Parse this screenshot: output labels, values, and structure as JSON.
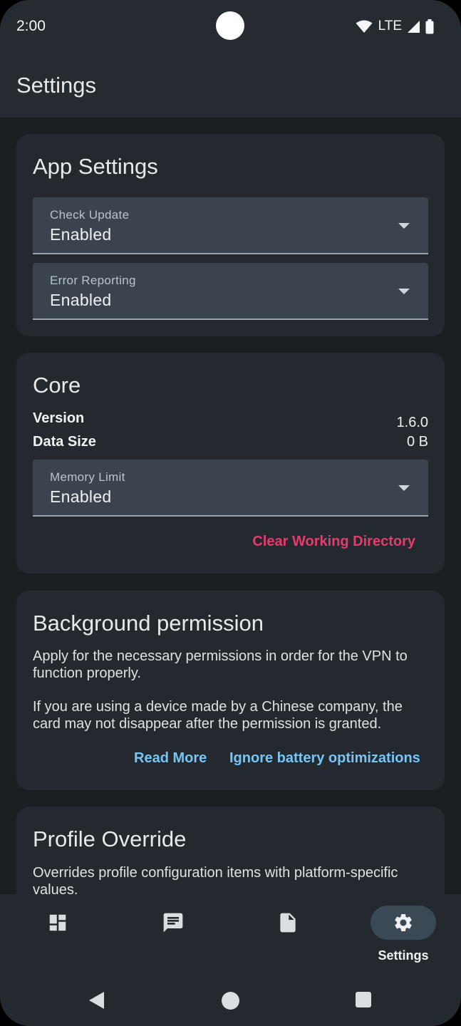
{
  "status_bar": {
    "time": "2:00",
    "network": "LTE",
    "icons": [
      "wifi-icon",
      "signal-icon",
      "battery-icon"
    ]
  },
  "app_bar": {
    "title": "Settings"
  },
  "app_settings": {
    "title": "App Settings",
    "check_update": {
      "label": "Check Update",
      "value": "Enabled"
    },
    "error_reporting": {
      "label": "Error Reporting",
      "value": "Enabled"
    }
  },
  "core": {
    "title": "Core",
    "version_label": "Version",
    "version_value": "1.6.0",
    "data_size_label": "Data Size",
    "data_size_value": "0 B",
    "memory_limit": {
      "label": "Memory Limit",
      "value": "Enabled"
    },
    "clear_button": "Clear Working Directory"
  },
  "background_permission": {
    "title": "Background permission",
    "description": "Apply for the necessary permissions in order for the VPN to function properly.",
    "note": "If you are using a device made by a Chinese company, the card may not disappear after the permission is granted.",
    "read_more": "Read More",
    "ignore_battery": "Ignore battery optimizations"
  },
  "profile_override": {
    "title": "Profile Override",
    "description": "Overrides profile configuration items with platform-specific values."
  },
  "bottom_nav": {
    "items": [
      {
        "icon": "dashboard-icon"
      },
      {
        "icon": "message-icon"
      },
      {
        "icon": "document-icon"
      },
      {
        "icon": "gear-icon",
        "label": "Settings",
        "active": true
      }
    ]
  },
  "colors": {
    "background": "#1b1f22",
    "card": "#23292f",
    "select": "#3b444c",
    "accent_pink": "#e53b6d",
    "accent_blue": "#76c5f5"
  }
}
